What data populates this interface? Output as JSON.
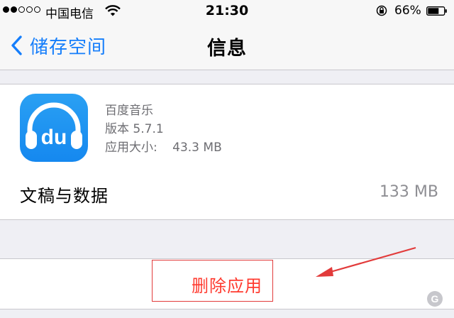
{
  "status_bar": {
    "signal_bars_filled": 2,
    "signal_bars_total": 5,
    "carrier": "中国电信",
    "time": "21:30",
    "battery_percent": "66%"
  },
  "nav": {
    "back_label": "储存空间",
    "title": "信息"
  },
  "app": {
    "icon_text": "du",
    "name": "百度音乐",
    "version": "版本 5.7.1",
    "size_label": "应用大小:",
    "size_value": "43.3 MB"
  },
  "documents": {
    "label": "文稿与数据",
    "value": "133 MB"
  },
  "actions": {
    "delete_label": "删除应用"
  },
  "watermark": "G",
  "colors": {
    "accent": "#157efb",
    "destructive": "#ff3b30",
    "annotation": "#e23b3b",
    "app_icon": "#1b8ff1"
  }
}
